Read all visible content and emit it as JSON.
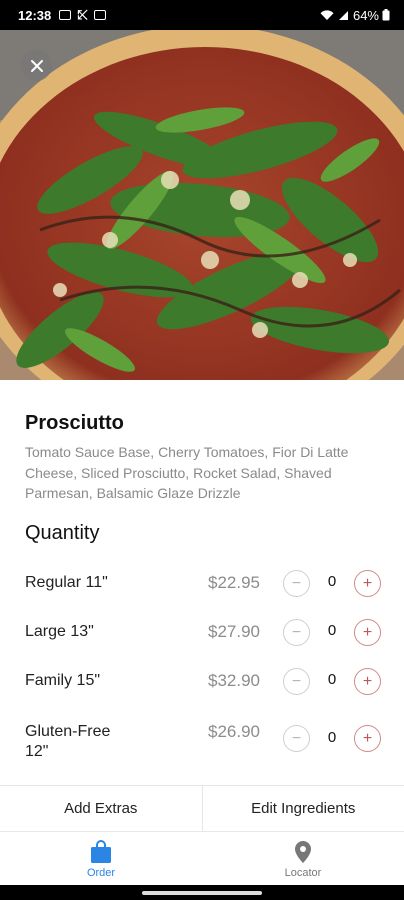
{
  "status_bar": {
    "time": "12:38",
    "battery_pct": "64%"
  },
  "product": {
    "name": "Prosciutto",
    "description": "Tomato Sauce Base, Cherry Tomatoes, Fior Di Latte Cheese, Sliced Prosciutto, Rocket Salad, Shaved Parmesan, Balsamic Glaze Drizzle"
  },
  "quantity": {
    "heading": "Quantity",
    "rows": [
      {
        "size": "Regular 11\"",
        "price": "$22.95",
        "count": "0"
      },
      {
        "size": "Large 13\"",
        "price": "$27.90",
        "count": "0"
      },
      {
        "size": "Family 15\"",
        "price": "$32.90",
        "count": "0"
      },
      {
        "size": "Gluten-Free 12\"",
        "price": "$26.90",
        "count": "0"
      }
    ],
    "minus_symbol": "−",
    "plus_symbol": "+"
  },
  "actions": {
    "add_extras": "Add Extras",
    "edit_ingredients": "Edit Ingredients"
  },
  "nav": {
    "order": "Order",
    "locator": "Locator"
  },
  "colors": {
    "accent_blue": "#2b85e4",
    "plus_red": "#c05656"
  },
  "icons": {
    "close": "close-icon",
    "order": "shopping-bag-icon",
    "locator": "map-pin-icon"
  }
}
